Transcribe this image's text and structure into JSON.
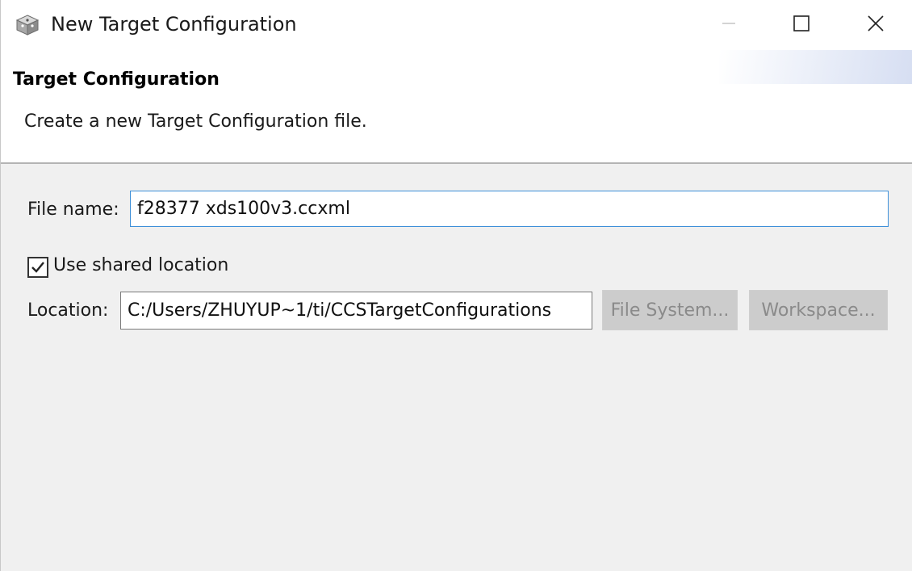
{
  "window": {
    "title": "New Target Configuration",
    "controls": {
      "minimize_icon": "minimize-icon",
      "maximize_icon": "maximize-icon",
      "close_icon": "close-icon"
    }
  },
  "header": {
    "title": "Target Configuration",
    "description": "Create a new Target Configuration file."
  },
  "form": {
    "file_name_label": "File name:",
    "file_name_value": "f28377 xds100v3.ccxml",
    "use_shared_location_label": "Use shared location",
    "use_shared_location_checked": true,
    "location_label": "Location:",
    "location_value": "C:/Users/ZHUYUP~1/ti/CCSTargetConfigurations",
    "file_system_button": "File System...",
    "workspace_button": "Workspace...",
    "browse_buttons_enabled": false
  },
  "colors": {
    "focus_border": "#3c8fd8",
    "dialog_background": "#f0f0f0",
    "disabled_button": "#cccccc",
    "disabled_text": "#8a8a8a"
  }
}
